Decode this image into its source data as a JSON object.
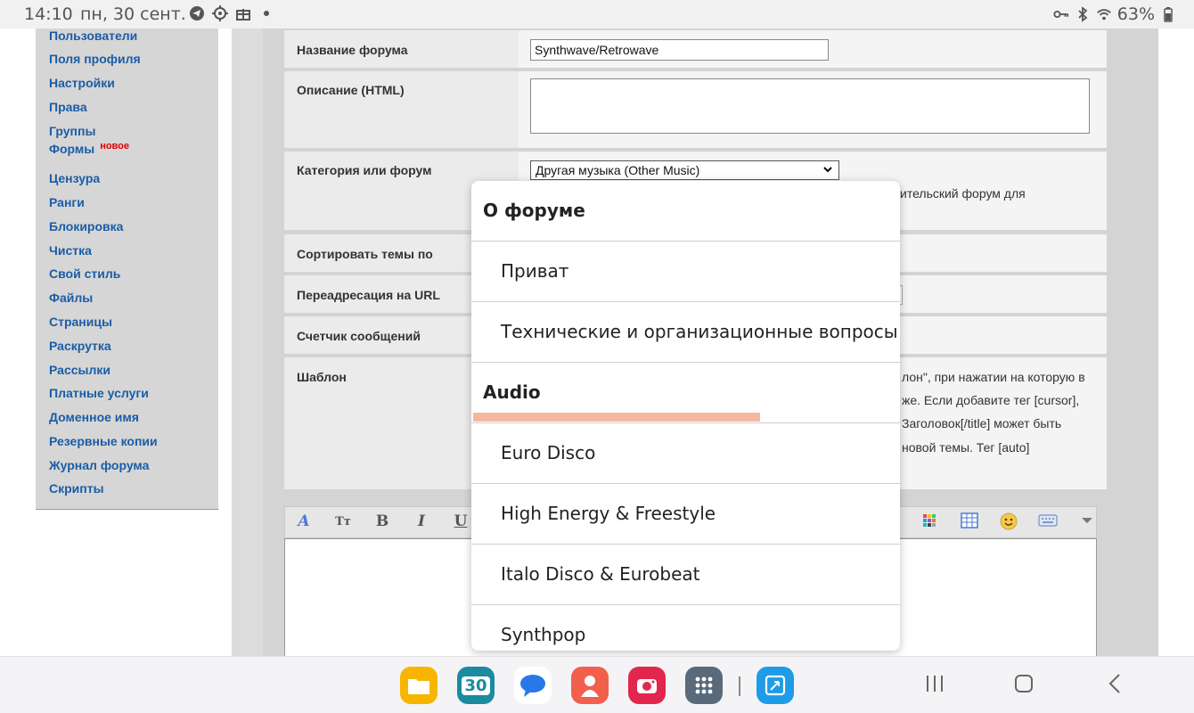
{
  "status_bar": {
    "time": "14:10",
    "date": "пн, 30 сент.",
    "battery": "63%",
    "icons": [
      "telegram-icon",
      "location-icon",
      "gift-icon",
      "dot-icon",
      "key-icon",
      "bluetooth-icon",
      "wifi-icon",
      "battery-icon"
    ]
  },
  "sidebar": {
    "items": [
      {
        "label": "Пользователи"
      },
      {
        "label": "Поля профиля"
      },
      {
        "label": "Настройки"
      },
      {
        "label": "Права"
      },
      {
        "label": "Группы"
      },
      {
        "label": "Формы",
        "badge": "новое"
      },
      {
        "label": "Цензура"
      },
      {
        "label": "Ранги"
      },
      {
        "label": "Блокировка"
      },
      {
        "label": "Чистка"
      },
      {
        "label": "Свой стиль"
      },
      {
        "label": "Файлы"
      },
      {
        "label": "Страницы"
      },
      {
        "label": "Раскрутка"
      },
      {
        "label": "Рассылки"
      },
      {
        "label": "Платные услуги"
      },
      {
        "label": "Доменное имя"
      },
      {
        "label": "Резервные копии"
      },
      {
        "label": "Журнал форума"
      },
      {
        "label": "Скрипты"
      }
    ]
  },
  "form": {
    "forum_name_label": "Название форума",
    "forum_name_value": "Synthwave/Retrowave",
    "description_label": "Описание (HTML)",
    "category_label": "Категория или форум",
    "category_value": "Другая музыка (Other Music)",
    "category_hint": "ительский форум для",
    "sort_label": "Сортировать темы по",
    "redirect_label": "Переадресация на URL",
    "counter_label": "Счетчик сообщений",
    "template_label": "Шаблон",
    "template_hint_1": "лон\", при нажатии на которую в",
    "template_hint_2": "же. Если добавите тег [cursor],",
    "template_hint_3": "Заголовок[/title] может быть",
    "template_hint_4": "новой темы. Тег [auto]"
  },
  "toolbar": {
    "font_btn": "A",
    "size_btn": "Tт",
    "bold_btn": "B",
    "italic_btn": "I",
    "underline_btn": "U"
  },
  "dropdown": {
    "items": [
      {
        "label": "О форуме",
        "group": true
      },
      {
        "label": "Приват",
        "group": false
      },
      {
        "label": "Технические и организационные вопросы",
        "group": false
      },
      {
        "label": "Audio",
        "group": true
      },
      {
        "label": "Euro Disco",
        "group": false
      },
      {
        "label": "High Energy & Freestyle",
        "group": false
      },
      {
        "label": "Italo Disco & Eurobeat",
        "group": false
      },
      {
        "label": "Synthpop",
        "group": false
      }
    ]
  },
  "navbar": {
    "calendar_day": "30",
    "apps": [
      "files-icon",
      "calendar-icon",
      "messages-icon",
      "contacts-icon",
      "camera-icon",
      "apps-grid-icon",
      "screenshot-icon"
    ]
  }
}
